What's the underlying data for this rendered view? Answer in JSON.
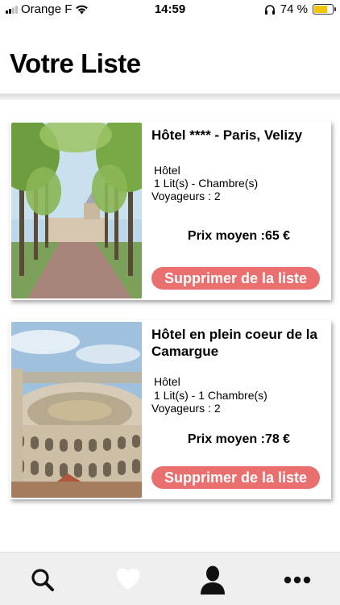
{
  "status_bar": {
    "carrier": "Orange F",
    "time": "14:59",
    "battery": "74 %",
    "battery_level": 0.74
  },
  "page_title": "Votre Liste",
  "listings": [
    {
      "title": "Hôtel **** - Paris, Velizy",
      "type": "Hôtel",
      "beds": "1 Lit(s) -  Chambre(s)",
      "travellers": "Voyageurs : 2",
      "price": "Prix moyen :65 €",
      "remove_label": "Supprimer de la liste"
    },
    {
      "title": "Hôtel en plein coeur de la Camargue",
      "type": "Hôtel",
      "beds": "1 Lit(s) - 1 Chambre(s)",
      "travellers": "Voyageurs : 2",
      "price": "Prix moyen :78 €",
      "remove_label": "Supprimer de la liste"
    }
  ],
  "tab_bar": {
    "icons": [
      "search-icon",
      "heart-icon",
      "user-icon",
      "more-icon"
    ],
    "active": "user-icon"
  },
  "colors": {
    "remove_button": "#ea6f6f",
    "tab_bar_bg": "#efefef",
    "battery": "#f5c400"
  }
}
